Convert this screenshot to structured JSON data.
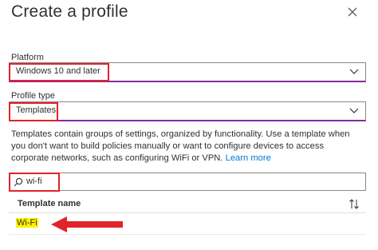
{
  "panel": {
    "title": "Create a profile",
    "close_icon": "close-icon"
  },
  "platform": {
    "label": "Platform",
    "value": "Windows 10 and later"
  },
  "profile_type": {
    "label": "Profile type",
    "value": "Templates"
  },
  "description": {
    "text": "Templates contain groups of settings, organized by functionality. Use a template when you don't want to build policies manually or want to configure devices to access corporate networks, such as configuring WiFi or VPN.",
    "link": "Learn more"
  },
  "search": {
    "icon": "search-icon",
    "value": "wi-fi"
  },
  "table": {
    "header": "Template name",
    "sort_icon": "sort-icon",
    "rows": [
      {
        "name": "Wi-Fi"
      }
    ]
  },
  "colors": {
    "highlight_box": "#e0242c",
    "focus_border": "#8a2aa2",
    "link": "#0078d4",
    "text_highlight": "#fff200"
  }
}
